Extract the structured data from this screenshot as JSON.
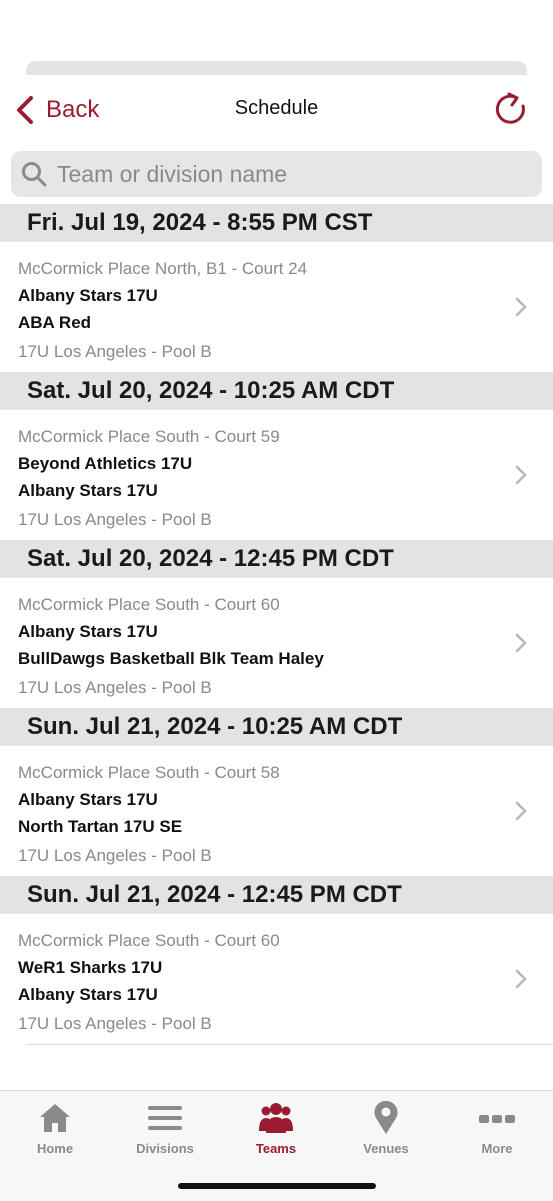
{
  "nav": {
    "back_label": "Back",
    "title": "Schedule"
  },
  "search": {
    "placeholder": "Team or division name"
  },
  "games": [
    {
      "date": "Fri. Jul 19, 2024 - 8:55 PM CST",
      "venue": "McCormick Place North, B1 - Court 24",
      "team1": "Albany Stars 17U",
      "team2": "ABA Red",
      "division": "17U Los Angeles - Pool B"
    },
    {
      "date": "Sat. Jul 20, 2024 - 10:25 AM CDT",
      "venue": "McCormick Place South - Court 59",
      "team1": "Beyond Athletics 17U",
      "team2": "Albany Stars 17U",
      "division": "17U Los Angeles - Pool B"
    },
    {
      "date": "Sat. Jul 20, 2024 - 12:45 PM CDT",
      "venue": "McCormick Place South - Court 60",
      "team1": "Albany Stars 17U",
      "team2": "BullDawgs Basketball Blk Team Haley",
      "division": "17U Los Angeles - Pool B"
    },
    {
      "date": "Sun. Jul 21, 2024 - 10:25 AM CDT",
      "venue": "McCormick Place South - Court 58",
      "team1": "Albany Stars 17U",
      "team2": "North Tartan 17U SE",
      "division": "17U Los Angeles - Pool B"
    },
    {
      "date": "Sun. Jul 21, 2024 - 12:45 PM CDT",
      "venue": "McCormick Place South - Court 60",
      "team1": "WeR1 Sharks 17U",
      "team2": "Albany Stars 17U",
      "division": "17U Los Angeles - Pool B"
    }
  ],
  "tabs": [
    {
      "label": "Home",
      "icon": "home-icon",
      "active": false
    },
    {
      "label": "Divisions",
      "icon": "list-icon",
      "active": false
    },
    {
      "label": "Teams",
      "icon": "people-icon",
      "active": true
    },
    {
      "label": "Venues",
      "icon": "location-pin-icon",
      "active": false
    },
    {
      "label": "More",
      "icon": "more-dots-icon",
      "active": false
    }
  ],
  "colors": {
    "accent": "#9b1b30",
    "header_bg": "#e3e3e3",
    "inactive": "#8a8a8a"
  }
}
